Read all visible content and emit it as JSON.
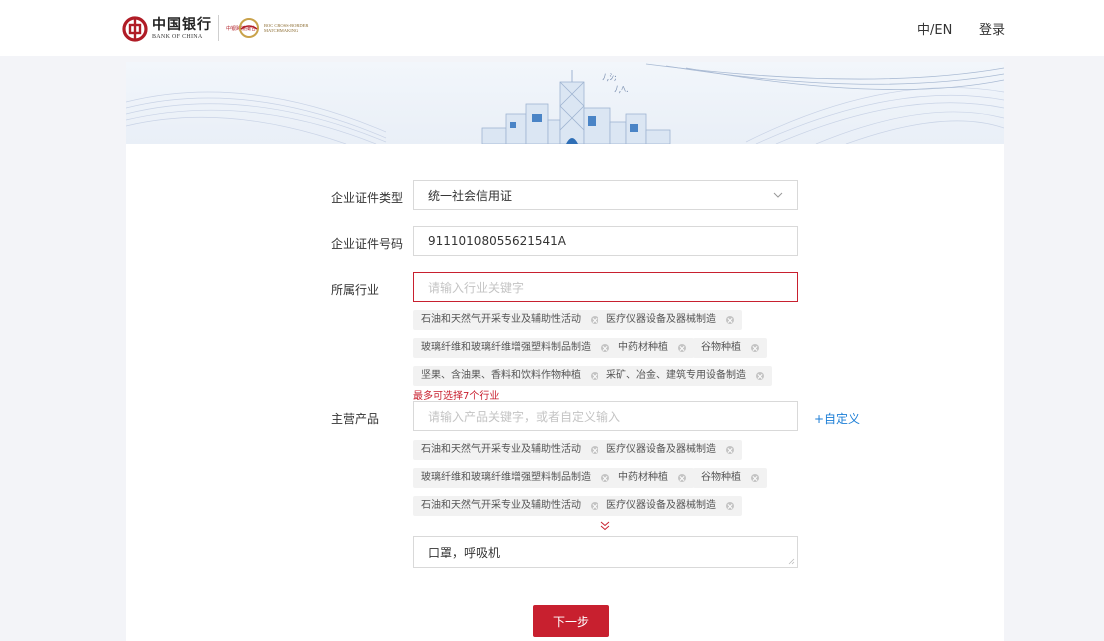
{
  "header": {
    "boc_logo_cn": "中国银行",
    "boc_logo_en": "BANK OF CHINA",
    "cb_logo_cn": "中银跨境撮合",
    "cb_logo_en": "BOC CROSS-BORDER MATCHMAKING",
    "lang_switch": "中/EN",
    "login": "登录"
  },
  "form": {
    "cert_type": {
      "label": "企业证件类型",
      "value": "统一社会信用证"
    },
    "cert_number": {
      "label": "企业证件号码",
      "value": "91110108055621541A"
    },
    "industry": {
      "label": "所属行业",
      "placeholder": "请输入行业关键字",
      "tags": [
        "石油和天然气开采专业及辅助性活动",
        "医疗仪器设备及器械制造",
        "玻璃纤维和玻璃纤维增强塑料制品制造",
        "中药材种植",
        "谷物种植",
        "坚果、含油果、香料和饮料作物种植",
        "采矿、冶金、建筑专用设备制造"
      ],
      "limit_hint": "最多可选择7个行业"
    },
    "products": {
      "label": "主营产品",
      "placeholder": "请输入产品关键字，或者自定义输入",
      "custom_link": "+自定义",
      "tags": [
        "石油和天然气开采专业及辅助性活动",
        "医疗仪器设备及器械制造",
        "玻璃纤维和玻璃纤维增强塑料制品制造",
        "中药材种植",
        "谷物种植",
        "石油和天然气开采专业及辅助性活动",
        "医疗仪器设备及器械制造"
      ],
      "textarea_value": "口罩，呼吸机"
    },
    "next_button": "下一步"
  },
  "colors": {
    "accent_red": "#c8202f",
    "link_blue": "#1c7ed6",
    "page_bg": "#f3f4f8"
  },
  "icons": [
    "boc-logo-icon",
    "cross-border-emblem-icon",
    "chevron-down-icon",
    "tag-remove-icon",
    "expand-more-icon",
    "resize-grip-icon"
  ]
}
